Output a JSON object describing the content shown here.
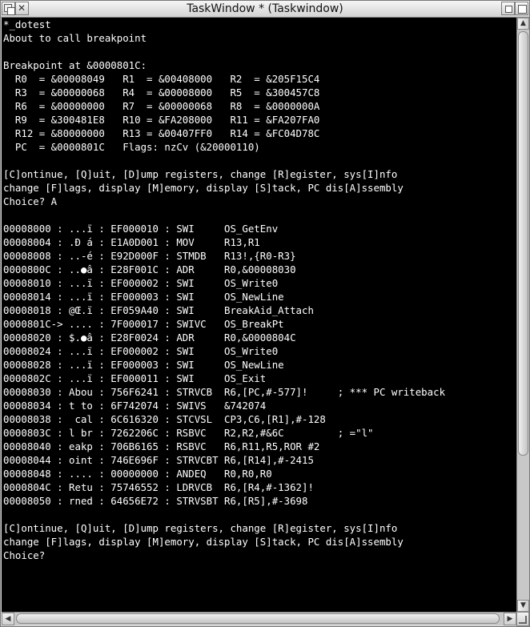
{
  "window": {
    "title": "TaskWindow * (Taskwindow)"
  },
  "console": {
    "lines": [
      "*_dotest",
      "About to call breakpoint",
      "",
      "Breakpoint at &0000801C:",
      "  R0  = &00008049   R1  = &00408000   R2  = &205F15C4",
      "  R3  = &00000068   R4  = &00008000   R5  = &300457C8",
      "  R6  = &00000000   R7  = &00000068   R8  = &0000000A",
      "  R9  = &300481E8   R10 = &FA208000   R11 = &FA207FA0",
      "  R12 = &80000000   R13 = &00407FF0   R14 = &FC04D78C",
      "  PC  = &0000801C   Flags: nzCv (&20000110)",
      "",
      "[C]ontinue, [Q]uit, [D]ump registers, change [R]egister, sys[I]nfo",
      "change [F]lags, display [M]emory, display [S]tack, PC dis[A]ssembly",
      "Choice? A",
      "",
      "00008000 : ...ï : EF000010 : SWI     OS_GetEnv",
      "00008004 : .Ð á : E1A0D001 : MOV     R13,R1",
      "00008008 : ..-é : E92D000F : STMDB   R13!,{R0-R3}",
      "0000800C : ..●â : E28F001C : ADR     R0,&00008030",
      "00008010 : ...ï : EF000002 : SWI     OS_Write0",
      "00008014 : ...ï : EF000003 : SWI     OS_NewLine",
      "00008018 : @Œ.ï : EF059A40 : SWI     BreakAid_Attach",
      "0000801C-> .... : 7F000017 : SWIVC   OS_BreakPt",
      "00008020 : $.●â : E28F0024 : ADR     R0,&0000804C",
      "00008024 : ...ï : EF000002 : SWI     OS_Write0",
      "00008028 : ...ï : EF000003 : SWI     OS_NewLine",
      "0000802C : ...ï : EF000011 : SWI     OS_Exit",
      "00008030 : Abou : 756F6241 : STRVCB  R6,[PC,#-577]!     ; *** PC writeback",
      "00008034 : t to : 6F742074 : SWIVS   &742074",
      "00008038 :  cal : 6C616320 : STCVSL  CP3,C6,[R1],#-128",
      "0000803C : l br : 7262206C : RSBVC   R2,R2,#&6C         ; =\"l\"",
      "00008040 : eakp : 706B6165 : RSBVC   R6,R11,R5,ROR #2",
      "00008044 : oint : 746E696F : STRVCBT R6,[R14],#-2415",
      "00008048 : .... : 00000000 : ANDEQ   R0,R0,R0",
      "0000804C : Retu : 75746552 : LDRVCB  R6,[R4,#-1362]!",
      "00008050 : rned : 64656E72 : STRVSBT R6,[R5],#-3698",
      "",
      "[C]ontinue, [Q]uit, [D]ump registers, change [R]egister, sys[I]nfo",
      "change [F]lags, display [M]emory, display [S]tack, PC dis[A]ssembly",
      "Choice?"
    ]
  },
  "scrollbars": {
    "vertical_position": 0.72,
    "horizontal_position": 0.0
  },
  "colors": {
    "console_bg": "#000000",
    "console_fg": "#ffffff",
    "chrome": "#dddddd"
  }
}
